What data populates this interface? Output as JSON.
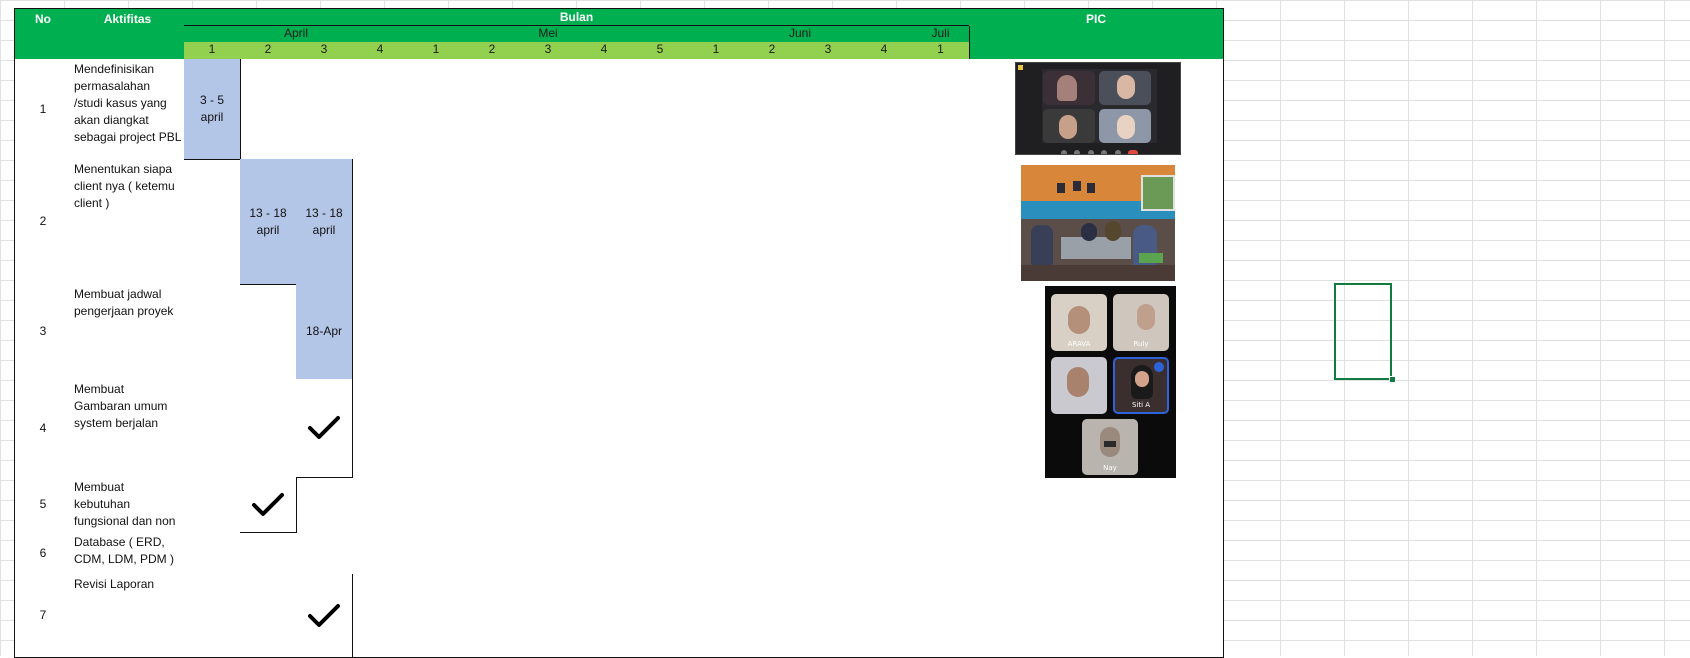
{
  "headers": {
    "no": "No",
    "aktifitas": "Aktifitas",
    "bulan": "Bulan",
    "pic": "PIC",
    "months": [
      "April",
      "Mei",
      "Juni",
      "Juli"
    ],
    "weeks": [
      "1",
      "2",
      "3",
      "4",
      "1",
      "2",
      "3",
      "4",
      "5",
      "1",
      "2",
      "3",
      "4",
      "1"
    ]
  },
  "rows": [
    {
      "no": "1",
      "activity": "Mendefinisikan permasalahan /studi kasus yang akan diangkat sebagai project PBL"
    },
    {
      "no": "2",
      "activity": "Menentukan siapa client nya ( ketemu client )"
    },
    {
      "no": "3",
      "activity": "Membuat jadwal pengerjaan proyek"
    },
    {
      "no": "4",
      "activity": "Membuat Gambaran umum system berjalan"
    },
    {
      "no": "5",
      "activity": "Membuat kebutuhan fungsional dan non"
    },
    {
      "no": "6",
      "activity": "Database ( ERD, CDM, LDM, PDM )"
    },
    {
      "no": "7",
      "activity": "Revisi Laporan"
    }
  ],
  "schedule": {
    "r1_w1": "3 - 5 april",
    "r2_w2": "13 - 18 april",
    "r2_w3": "13 - 18 april",
    "r3_w3": "18-Apr"
  },
  "photos": {
    "call3_names": [
      "ARAVA",
      "Ruly",
      "",
      "Siti A",
      "Nay"
    ]
  },
  "colors": {
    "header_green": "#00b050",
    "week_green": "#92d050",
    "highlight_blue": "#b4c6e7",
    "selection_green": "#107c41"
  }
}
